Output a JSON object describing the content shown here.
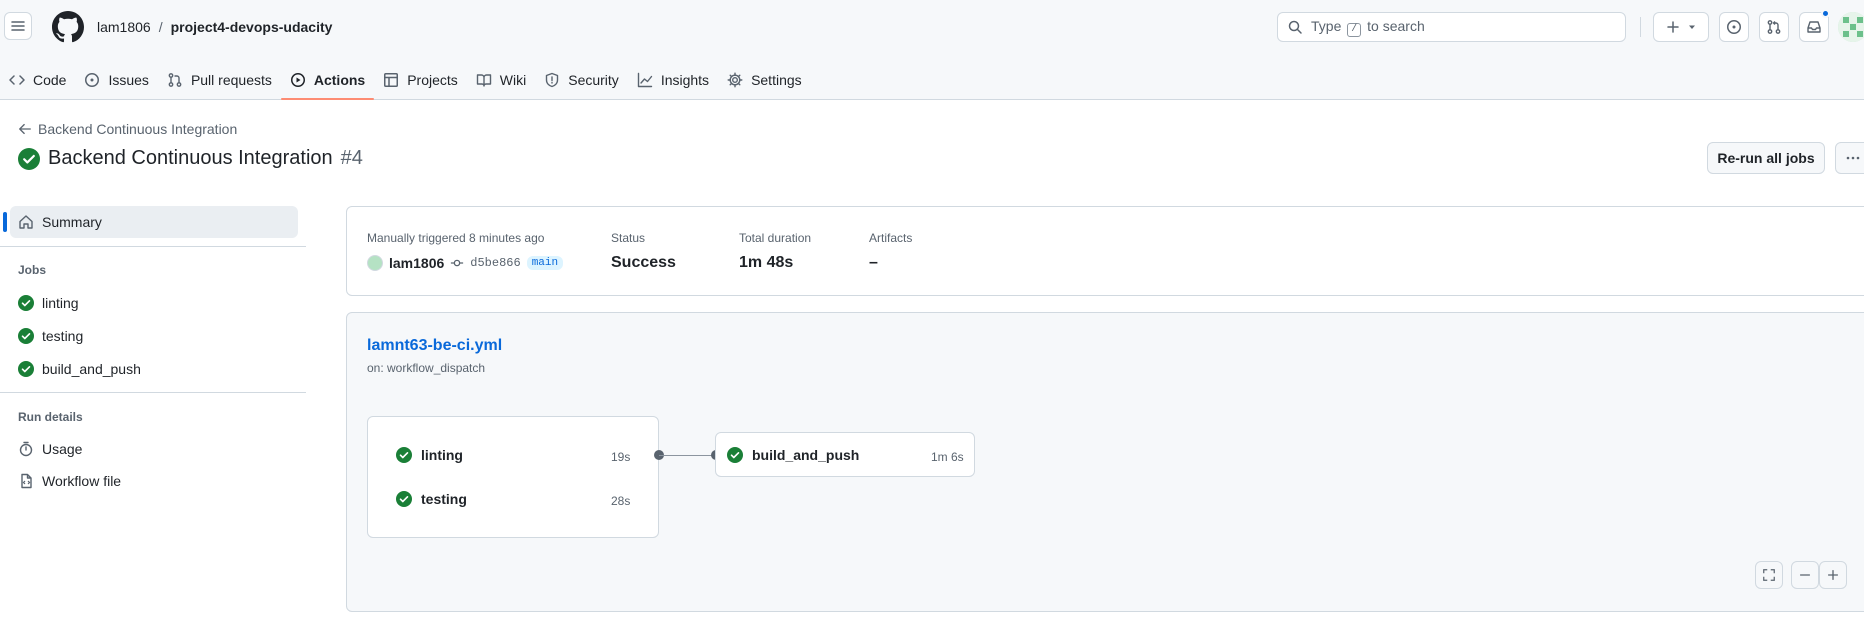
{
  "header": {
    "owner": "lam1806",
    "separator": "/",
    "repo": "project4-devops-udacity",
    "search_prefix": "Type",
    "search_key": "/",
    "search_suffix": "to search"
  },
  "tabs": [
    {
      "label": "Code",
      "icon": "code-icon"
    },
    {
      "label": "Issues",
      "icon": "issue-icon"
    },
    {
      "label": "Pull requests",
      "icon": "pull-request-icon"
    },
    {
      "label": "Actions",
      "icon": "play-icon",
      "active": true
    },
    {
      "label": "Projects",
      "icon": "table-icon"
    },
    {
      "label": "Wiki",
      "icon": "book-icon"
    },
    {
      "label": "Security",
      "icon": "shield-icon"
    },
    {
      "label": "Insights",
      "icon": "graph-icon"
    },
    {
      "label": "Settings",
      "icon": "gear-icon"
    }
  ],
  "run": {
    "back_label": "Backend Continuous Integration",
    "title": "Backend Continuous Integration",
    "number": "#4",
    "rerun_label": "Re-run all jobs"
  },
  "sidebar": {
    "summary_label": "Summary",
    "jobs_heading": "Jobs",
    "jobs": [
      "linting",
      "testing",
      "build_and_push"
    ],
    "details_heading": "Run details",
    "usage_label": "Usage",
    "workflow_file_label": "Workflow file"
  },
  "summary": {
    "trigger_label": "Manually triggered 8 minutes ago",
    "actor": "lam1806",
    "sha": "d5be866",
    "branch": "main",
    "status_label": "Status",
    "status_value": "Success",
    "duration_label": "Total duration",
    "duration_value": "1m 48s",
    "artifacts_label": "Artifacts",
    "artifacts_value": "–"
  },
  "graph": {
    "file": "lamnt63-be-ci.yml",
    "trigger": "on: workflow_dispatch",
    "jobs": [
      {
        "name": "linting",
        "duration": "19s"
      },
      {
        "name": "testing",
        "duration": "28s"
      },
      {
        "name": "build_and_push",
        "duration": "1m 6s"
      }
    ]
  },
  "colors": {
    "success": "#1a7f37",
    "accent": "#0969da",
    "active_tab_underline": "#fd8c73"
  }
}
